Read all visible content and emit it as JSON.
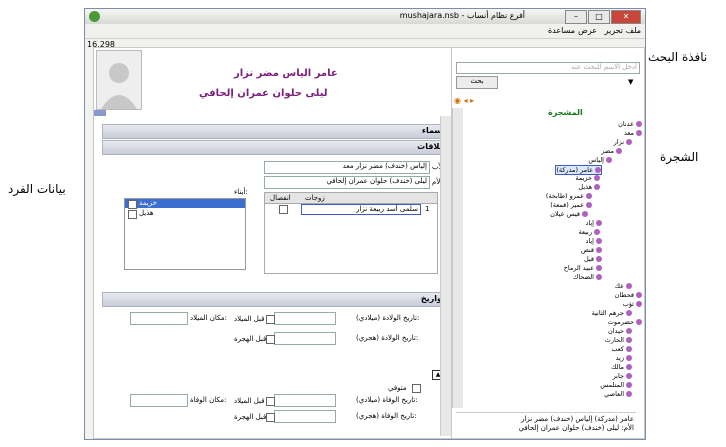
{
  "outer_labels": {
    "search_window": "نافذة البحث",
    "tree": "الشجرة",
    "person_data": "بيانات الفرد"
  },
  "window": {
    "title": "mushajara.nsb - أفرع نظام أنساب"
  },
  "menu": [
    "ملف",
    "تحرير",
    "عرض",
    "مساعدة"
  ],
  "counter": "16,298",
  "person": {
    "name": "عامر الياس مضر نزار",
    "mother": "ليلى حلوان عمران إلحافي"
  },
  "sections": {
    "names": "أسماء",
    "relations": "علاقات",
    "dates": "تواريخ"
  },
  "relations": {
    "father_label": "الأب:",
    "father_value": "إلياس (خندف) مضر نزار معد",
    "mother_label": "الأم:",
    "mother_value": "ليلى (خندف) حلوان عمران إلحافي",
    "spouses_header": "زوجات",
    "separation_header": "انفصال",
    "spouse_index": "1",
    "spouse_value": "سلمى أسد ربيعة نزار",
    "children_label": "أبناء:",
    "children": [
      "خزيمة",
      "هذيل"
    ]
  },
  "dates": {
    "birth_greg_label": "تاريخ الولادة (ميلادي):",
    "birth_hijri_label": "تاريخ الولادة (هجري):",
    "birth_place_label": "مكان الميلاد:",
    "before_greg": "قبل الميلاد",
    "before_hijri": "قبل الهجرة",
    "deceased_label": "متوفي",
    "death_greg_label": "تاريخ الوفاة (ميلادي):",
    "death_hijri_label": "تاريخ الوفاة (هجري):",
    "death_place_label": "مكان الوفاة:"
  },
  "search": {
    "placeholder": "أدخل الاسم للبحث عنه",
    "button": "بحث"
  },
  "tree": {
    "root": "المشجرة",
    "items": [
      "عدنان",
      "معد",
      "نزار",
      "مضر",
      "إلياس",
      "عامر (مدركة)",
      "خزيمة",
      "هذيل",
      "عمرو (طابخة)",
      "عمير (قمعة)",
      "قيس عيلان",
      "إياد",
      "ربيعة",
      "إياد",
      "قنص",
      "قيل",
      "عبيد الرماح",
      "الضحاك",
      "عك",
      "قحطان",
      "ثؤب",
      "جرهم الثانية",
      "حضرموت",
      "حيدان",
      "الحارث",
      "كعب",
      "زيد",
      "مالك",
      "جابر",
      "المتلمس",
      "العاصي"
    ]
  },
  "status": {
    "line1": "عامر (مدركة) إلياس (خندف) مضر نزار",
    "line2": "الأم: ليلى (خندف) حلوان عمران إلحافي"
  }
}
